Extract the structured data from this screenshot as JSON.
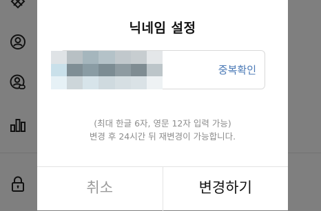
{
  "modal": {
    "title": "닉네임 설정",
    "nickname_field": {
      "value_state": "blurred / pixelated",
      "check_button_label": "중복확인"
    },
    "help_text": {
      "line1": "(최대 한글 6자, 영문 12자 입력 가능)",
      "line2": "변경 후 24시간 뒤 재변경이 가능합니다."
    },
    "cancel_label": "취소",
    "confirm_label": "변경하기"
  },
  "sidebar": {
    "icons": [
      "settings-icon",
      "user-icon",
      "user-link-icon",
      "chart-icon",
      "lock-icon"
    ]
  },
  "colors": {
    "overlay": "#7f7f7f",
    "modal_bg": "#ffffff",
    "link_blue": "#4a79b6",
    "muted_text": "#8c8c8c"
  }
}
